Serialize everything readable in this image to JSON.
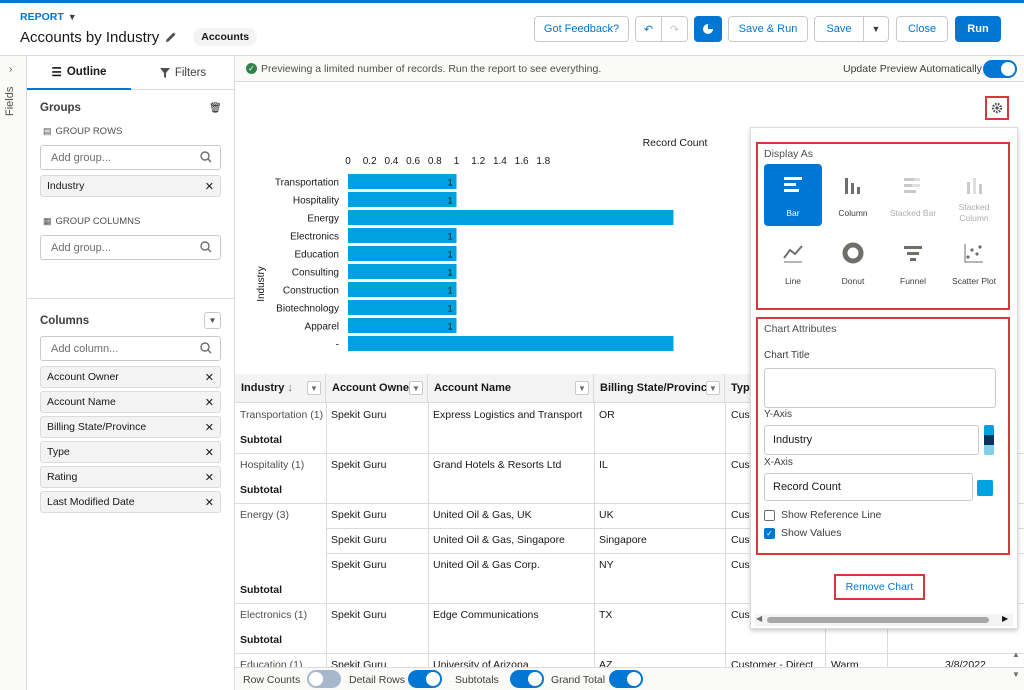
{
  "header": {
    "report_label": "REPORT",
    "title": "Accounts by Industry",
    "type_badge": "Accounts",
    "buttons": {
      "feedback": "Got Feedback?",
      "save_run": "Save & Run",
      "save": "Save",
      "close": "Close",
      "run": "Run"
    }
  },
  "fields_rail": {
    "label": "Fields"
  },
  "left_panel": {
    "tabs": {
      "outline": "Outline",
      "filters": "Filters"
    },
    "groups": {
      "title": "Groups",
      "rows_label": "GROUP ROWS",
      "rows_placeholder": "Add group...",
      "row_items": [
        "Industry"
      ],
      "columns_label": "GROUP COLUMNS",
      "columns_placeholder": "Add group..."
    },
    "columns": {
      "title": "Columns",
      "placeholder": "Add column...",
      "items": [
        "Account Owner",
        "Account Name",
        "Billing State/Province",
        "Type",
        "Rating",
        "Last Modified Date"
      ]
    }
  },
  "preview_bar": {
    "message": "Previewing a limited number of records. Run the report to see everything.",
    "auto_update_label": "Update Preview Automatically",
    "auto_update_on": true
  },
  "chart_data": {
    "type": "bar",
    "orientation": "horizontal",
    "xlabel": "Record Count",
    "ylabel": "Industry",
    "xticks": [
      "0",
      "0.2",
      "0.4",
      "0.6",
      "0.8",
      "1",
      "1.2",
      "1.4",
      "1.6",
      "1.8"
    ],
    "xlim": [
      0,
      1.8
    ],
    "categories": [
      "Transportation",
      "Hospitality",
      "Energy",
      "Electronics",
      "Education",
      "Consulting",
      "Construction",
      "Biotechnology",
      "Apparel",
      "-"
    ],
    "values": [
      1,
      1,
      3,
      1,
      1,
      1,
      1,
      1,
      1,
      3
    ],
    "value_labels": [
      "1",
      "1",
      "",
      "1",
      "1",
      "1",
      "1",
      "1",
      "1",
      ""
    ],
    "bar_color": "#00a1e0"
  },
  "table": {
    "headers": [
      "Industry",
      "Account Owner",
      "Account Name",
      "Billing State/Province",
      "Typ"
    ],
    "rows": [
      {
        "industry": "Transportation (1)",
        "owner": "Spekit Guru",
        "name": "Express Logistics and Transport",
        "state": "OR",
        "type": "Cust"
      },
      {
        "industry": "Subtotal",
        "owner": "",
        "name": "",
        "state": "",
        "type": ""
      },
      {
        "industry": "Hospitality (1)",
        "owner": "Spekit Guru",
        "name": "Grand Hotels & Resorts Ltd",
        "state": "IL",
        "type": "Cust"
      },
      {
        "industry": "Subtotal",
        "owner": "",
        "name": "",
        "state": "",
        "type": ""
      },
      {
        "industry": "Energy (3)",
        "owner": "Spekit Guru",
        "name": "United Oil & Gas, UK",
        "state": "UK",
        "type": "Cust"
      },
      {
        "industry": "",
        "owner": "Spekit Guru",
        "name": "United Oil & Gas, Singapore",
        "state": "Singapore",
        "type": "Cust"
      },
      {
        "industry": "",
        "owner": "Spekit Guru",
        "name": "United Oil & Gas Corp.",
        "state": "NY",
        "type": "Cust"
      },
      {
        "industry": "Subtotal",
        "owner": "",
        "name": "",
        "state": "",
        "type": ""
      },
      {
        "industry": "Electronics (1)",
        "owner": "Spekit Guru",
        "name": "Edge Communications",
        "state": "TX",
        "type": "Cust"
      },
      {
        "industry": "Subtotal",
        "owner": "",
        "name": "",
        "state": "",
        "type": ""
      },
      {
        "industry": "Education (1)",
        "owner": "Spekit Guru",
        "name": "University of Arizona",
        "state": "AZ",
        "type": "Customer - Direct",
        "rating": "Warm",
        "date": "3/8/2022"
      }
    ]
  },
  "footer_toggles": [
    {
      "label": "Row Counts",
      "on": false
    },
    {
      "label": "Detail Rows",
      "on": true
    },
    {
      "label": "Subtotals",
      "on": true
    },
    {
      "label": "Grand Total",
      "on": true
    }
  ],
  "chart_panel": {
    "display_as_label": "Display As",
    "chart_types": [
      {
        "label": "Bar",
        "selected": true,
        "enabled": true
      },
      {
        "label": "Column",
        "selected": false,
        "enabled": true
      },
      {
        "label": "Stacked Bar",
        "selected": false,
        "enabled": false
      },
      {
        "label": "Stacked Column",
        "selected": false,
        "enabled": false
      },
      {
        "label": "Line",
        "selected": false,
        "enabled": true
      },
      {
        "label": "Donut",
        "selected": false,
        "enabled": true
      },
      {
        "label": "Funnel",
        "selected": false,
        "enabled": true
      },
      {
        "label": "Scatter Plot",
        "selected": false,
        "enabled": true
      }
    ],
    "attributes_label": "Chart Attributes",
    "chart_title_label": "Chart Title",
    "chart_title_value": "",
    "y_axis_label": "Y-Axis",
    "y_axis_value": "Industry",
    "x_axis_label": "X-Axis",
    "x_axis_value": "Record Count",
    "x_axis_color": "#00a1e0",
    "y_axis_colors": [
      "#00a1e0",
      "#0b2f57",
      "#7fd1e3"
    ],
    "show_reference_line_label": "Show Reference Line",
    "show_reference_line": false,
    "show_values_label": "Show Values",
    "show_values": true,
    "remove_chart": "Remove Chart"
  },
  "colors": {
    "brand": "#0176d3",
    "highlight": "#d9363e"
  }
}
